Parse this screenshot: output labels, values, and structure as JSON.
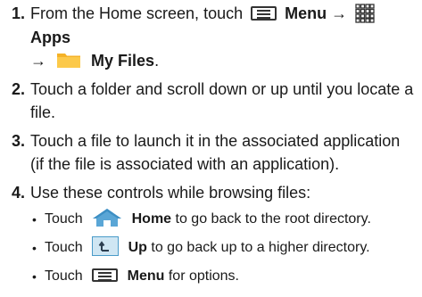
{
  "steps": [
    {
      "num": "1.",
      "text_a": "From the Home screen, touch",
      "menu_label": "Menu →",
      "apps_label": "Apps",
      "arrow": "→",
      "myfiles_label": "My Files",
      "end": "."
    },
    {
      "num": "2.",
      "text": "Touch a folder and scroll down or up until you locate a file."
    },
    {
      "num": "3.",
      "text": "Touch a file to launch it in the associated application (if the file is associated with an application)."
    },
    {
      "num": "4.",
      "text": "Use these controls while browsing files:"
    }
  ],
  "subs": [
    {
      "bullet": "•",
      "pre": "Touch",
      "label": "Home",
      "post": "to go back to the root directory.",
      "icon": "home-icon"
    },
    {
      "bullet": "•",
      "pre": "Touch",
      "label": "Up",
      "post": "to go back up to a higher directory.",
      "icon": "up-folder-icon"
    },
    {
      "bullet": "•",
      "pre": "Touch",
      "label": "Menu",
      "post": "for options.",
      "icon": "menu-icon"
    }
  ],
  "colors": {
    "folder": "#f5b227",
    "home": "#5aa6d6",
    "up": "#4a9bc9"
  }
}
